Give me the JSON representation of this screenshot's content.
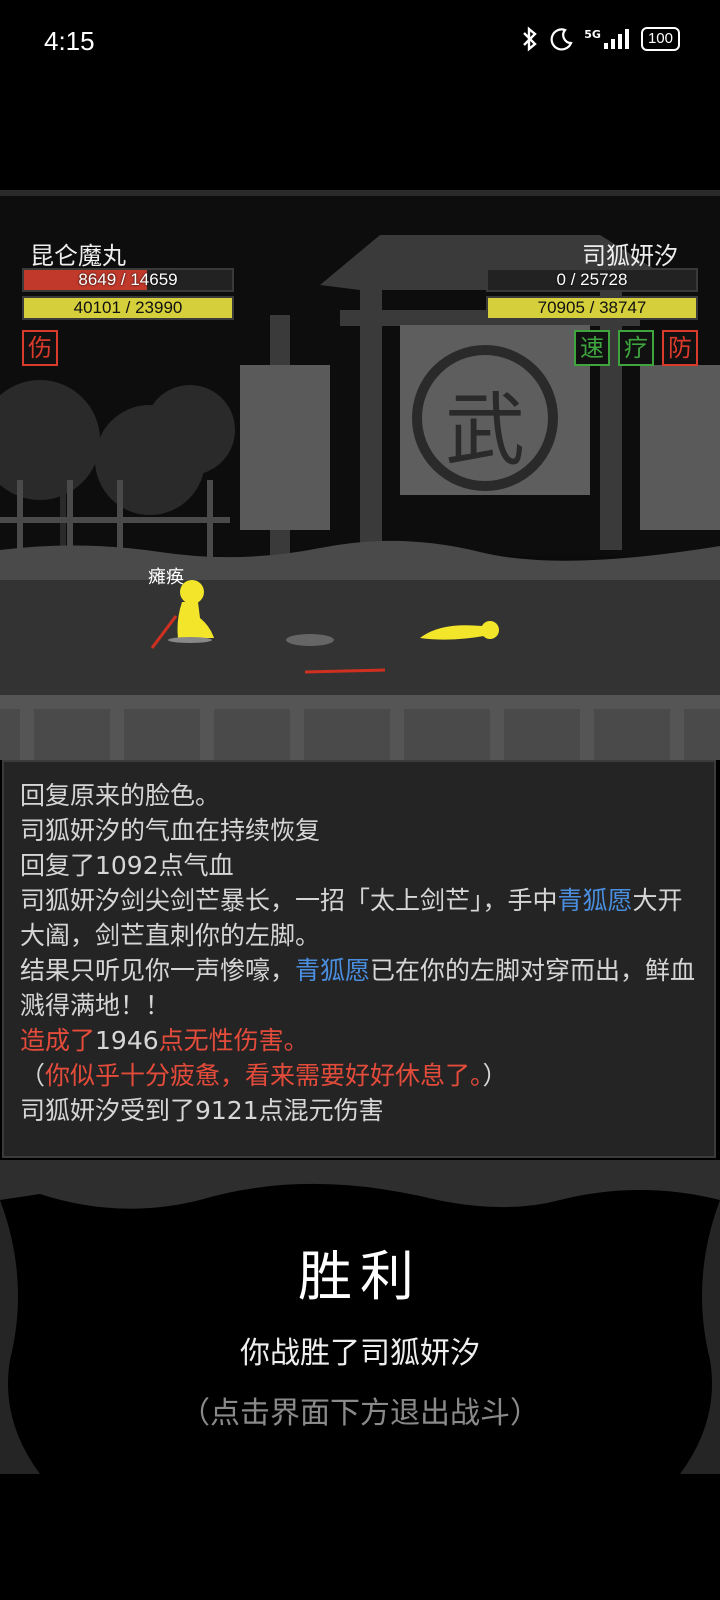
{
  "status_bar": {
    "time": "4:15",
    "battery": "100",
    "network": "5G"
  },
  "player": {
    "name": "昆仑魔丸",
    "hp_text": "8649 / 14659",
    "hp_fraction": 0.59,
    "mp_text": "40101 / 23990",
    "mp_fraction": 1.0,
    "status_badges": [
      {
        "label": "伤",
        "color": "#d93a2b"
      }
    ],
    "effect_label": "瘫痪"
  },
  "enemy": {
    "name": "司狐妍汐",
    "hp_text": "0 / 25728",
    "hp_fraction": 0.0,
    "mp_text": "70905 / 38747",
    "mp_fraction": 1.0,
    "status_badges": [
      {
        "label": "速",
        "color": "#3ea43e"
      },
      {
        "label": "疗",
        "color": "#3ea43e"
      },
      {
        "label": "防",
        "color": "#d93a2b"
      }
    ]
  },
  "scene": {
    "temple_glyph": "武"
  },
  "combat_log": [
    [
      {
        "t": "回复原来的脸色。"
      }
    ],
    [
      {
        "t": "司狐妍汐的气血在持续恢复"
      }
    ],
    [
      {
        "t": "回复了1092点气血"
      }
    ],
    [
      {
        "t": "司狐妍汐剑尖剑芒暴长，一招「太上剑芒」，手中"
      },
      {
        "t": "青狐愿",
        "c": "blue"
      },
      {
        "t": "大开大阖，剑芒直刺你的左脚。"
      }
    ],
    [
      {
        "t": "结果只听见你一声惨嚎，"
      },
      {
        "t": "青狐愿",
        "c": "blue"
      },
      {
        "t": "已在你的左脚对穿而出，鲜血溅得满地！！"
      }
    ],
    [
      {
        "t": "造成了",
        "c": "red"
      },
      {
        "t": "1946"
      },
      {
        "t": "点无性伤害。",
        "c": "red"
      }
    ],
    [
      {
        "t": "（"
      },
      {
        "t": "你似乎十分疲惫，看来需要好好休息了。",
        "c": "red"
      },
      {
        "t": "）"
      }
    ],
    [
      {
        "t": "司狐妍汐受到了9121点混元伤害"
      }
    ]
  ],
  "result": {
    "title": "胜利",
    "subtitle": "你战胜了司狐妍汐",
    "hint": "（点击界面下方退出战斗）"
  },
  "colors": {
    "hp": "#c0392b",
    "mp": "#d4cf3a",
    "character": "#f2e52a",
    "weapon": "#d0301f"
  }
}
